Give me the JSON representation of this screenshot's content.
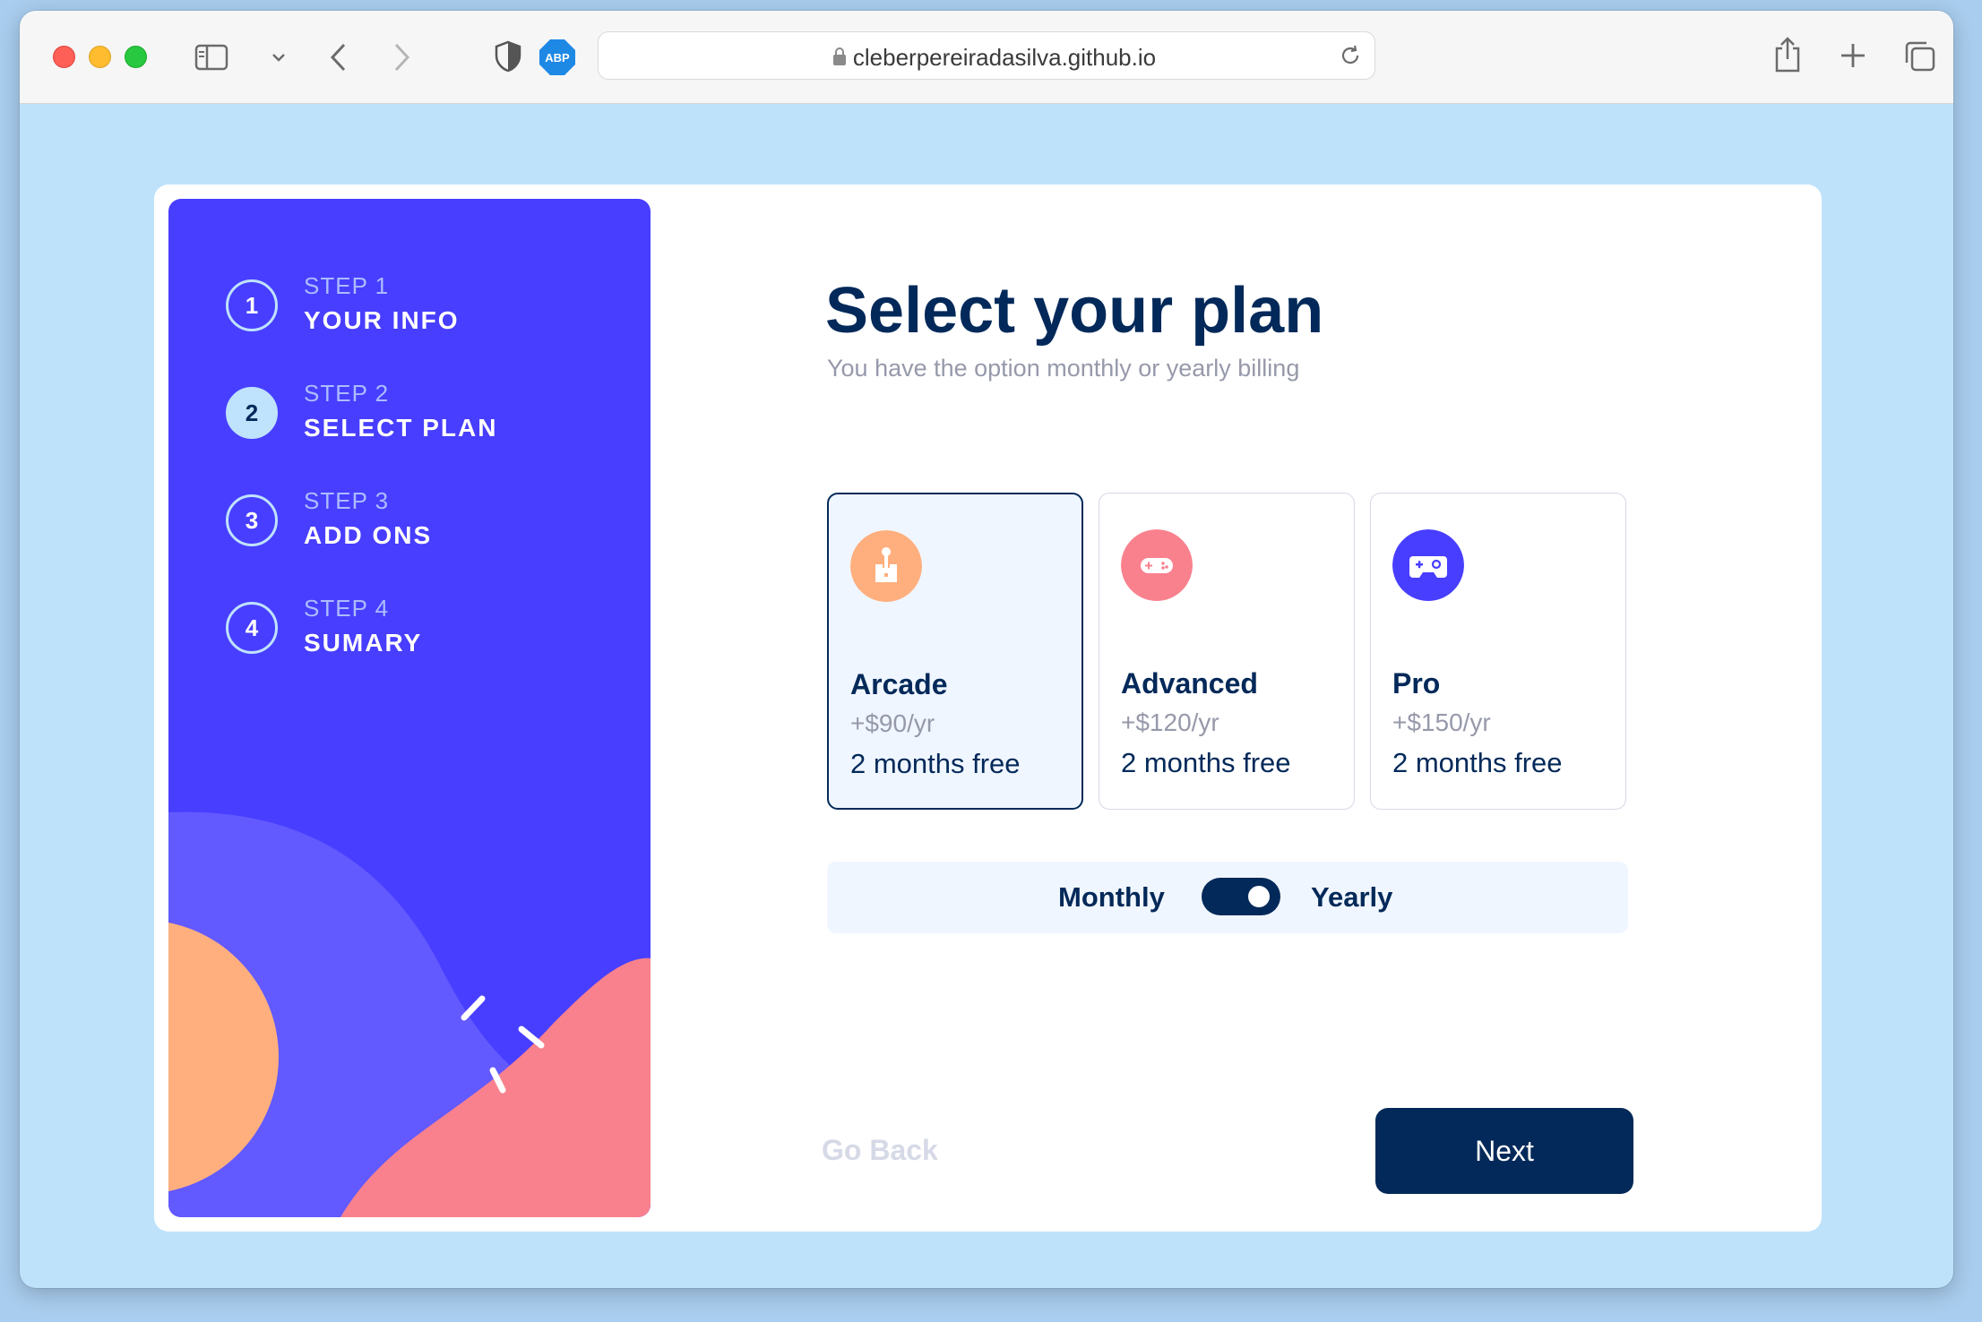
{
  "browser": {
    "url": "cleberpereiradasilva.github.io",
    "adblock_label": "ABP"
  },
  "sidebar": {
    "steps": [
      {
        "number": "1",
        "kicker": "STEP 1",
        "title": "YOUR INFO",
        "active": false
      },
      {
        "number": "2",
        "kicker": "STEP 2",
        "title": "SELECT PLAN",
        "active": true
      },
      {
        "number": "3",
        "kicker": "STEP 3",
        "title": "ADD ONS",
        "active": false
      },
      {
        "number": "4",
        "kicker": "STEP 4",
        "title": "SUMARY",
        "active": false
      }
    ]
  },
  "main": {
    "title": "Select your plan",
    "subtitle": "You have the option monthly or yearly billing",
    "plans": [
      {
        "name": "Arcade",
        "price": "+$90/yr",
        "free": "2 months free",
        "icon": "arcade-icon",
        "color": "#ffaf7e",
        "selected": true
      },
      {
        "name": "Advanced",
        "price": "+$120/yr",
        "free": "2 months free",
        "icon": "gamepad-icon",
        "color": "#f9818e",
        "selected": false
      },
      {
        "name": "Pro",
        "price": "+$150/yr",
        "free": "2 months free",
        "icon": "controller-icon",
        "color": "#483eff",
        "selected": false
      }
    ],
    "billing": {
      "monthly": "Monthly",
      "yearly": "Yearly",
      "selected": "Yearly"
    }
  },
  "footer": {
    "back_label": "Go Back",
    "next_label": "Next"
  },
  "colors": {
    "marine_blue": "#022959",
    "purplish_blue": "#483eff",
    "light_blue": "#bfe2fd",
    "orange": "#ffaf7e",
    "pink": "#f9818e",
    "grey": "#9699aa"
  }
}
